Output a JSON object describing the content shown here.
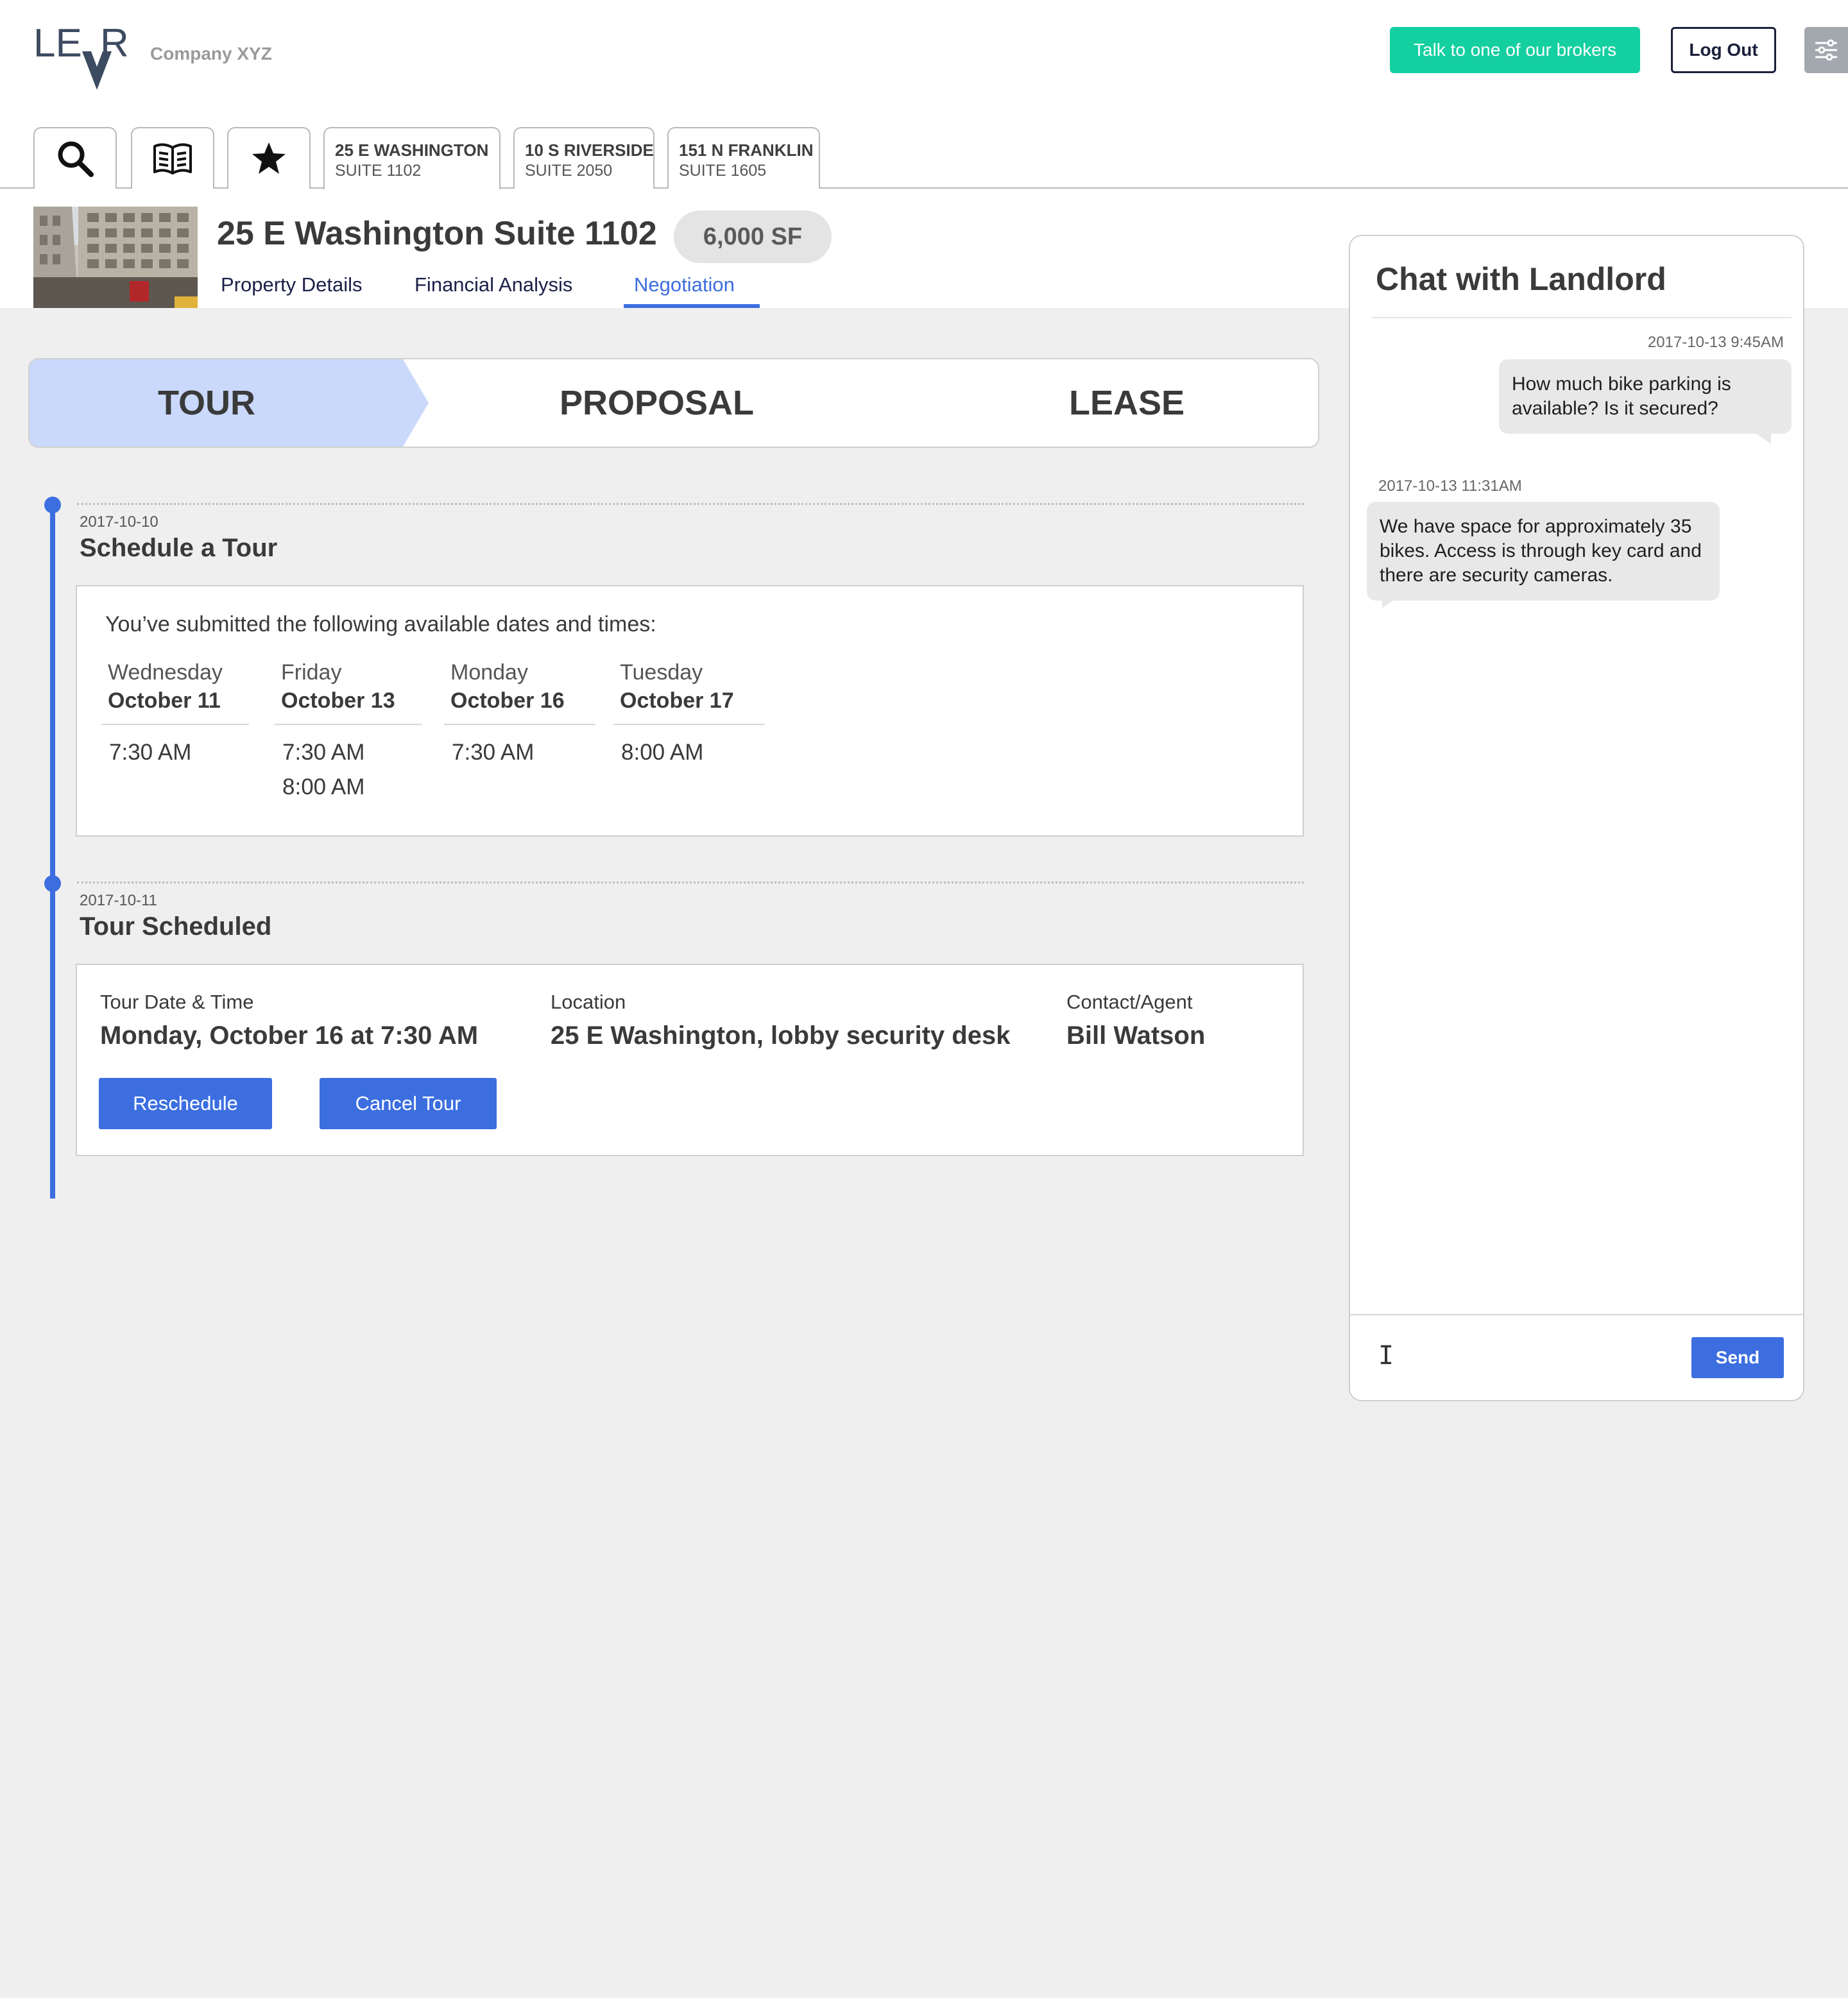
{
  "header": {
    "company": "Company XYZ",
    "broker_button": "Talk to one of our brokers",
    "logout_button": "Log Out"
  },
  "tabs": {
    "icons": [
      "search-icon",
      "book-icon",
      "star-icon"
    ],
    "properties": [
      {
        "line1": "25 E WASHINGTON",
        "line2": "SUITE 1102",
        "active": true
      },
      {
        "line1": "10 S RIVERSIDE",
        "line2": "SUITE 2050",
        "active": false
      },
      {
        "line1": "151 N FRANKLIN",
        "line2": "SUITE 1605",
        "active": false
      }
    ]
  },
  "property": {
    "title": "25 E Washington Suite 1102",
    "size": "6,000 SF",
    "subtabs": [
      "Property Details",
      "Financial Analysis",
      "Negotiation"
    ],
    "active_subtab": "Negotiation"
  },
  "stages": {
    "items": [
      "TOUR",
      "PROPOSAL",
      "LEASE"
    ],
    "active": "TOUR"
  },
  "timeline": {
    "events": [
      {
        "date": "2017-10-10",
        "title": "Schedule a Tour",
        "intro": "You’ve submitted the following available dates and times:",
        "days": [
          {
            "weekday": "Wednesday",
            "date": "October 11",
            "times": [
              "7:30 AM"
            ]
          },
          {
            "weekday": "Friday",
            "date": "October 13",
            "times": [
              "7:30 AM",
              "8:00 AM"
            ]
          },
          {
            "weekday": "Monday",
            "date": "October 16",
            "times": [
              "7:30 AM"
            ]
          },
          {
            "weekday": "Tuesday",
            "date": "October 17",
            "times": [
              "8:00 AM"
            ]
          }
        ]
      },
      {
        "date": "2017-10-11",
        "title": "Tour Scheduled",
        "fields": [
          {
            "label": "Tour Date & Time",
            "value": "Monday, October 16 at 7:30 AM"
          },
          {
            "label": "Location",
            "value": "25 E Washington, lobby security desk"
          },
          {
            "label": "Contact/Agent",
            "value": "Bill Watson"
          }
        ],
        "buttons": [
          "Reschedule",
          "Cancel Tour"
        ]
      }
    ]
  },
  "chat": {
    "title": "Chat with Landlord",
    "messages": [
      {
        "time": "2017-10-13 9:45AM",
        "side": "right",
        "text": "How much bike parking is available? Is it secured?"
      },
      {
        "time": "2017-10-13 11:31AM",
        "side": "left",
        "text": "We have space for approximately 35 bikes. Access is through key card and there are security cameras."
      }
    ],
    "input_placeholder": "",
    "send_button": "Send"
  },
  "colors": {
    "accent": "#3c6ee0",
    "broker_green": "#14cfa0",
    "stage_active": "#cad9fb",
    "navy": "#1a1f3a"
  }
}
